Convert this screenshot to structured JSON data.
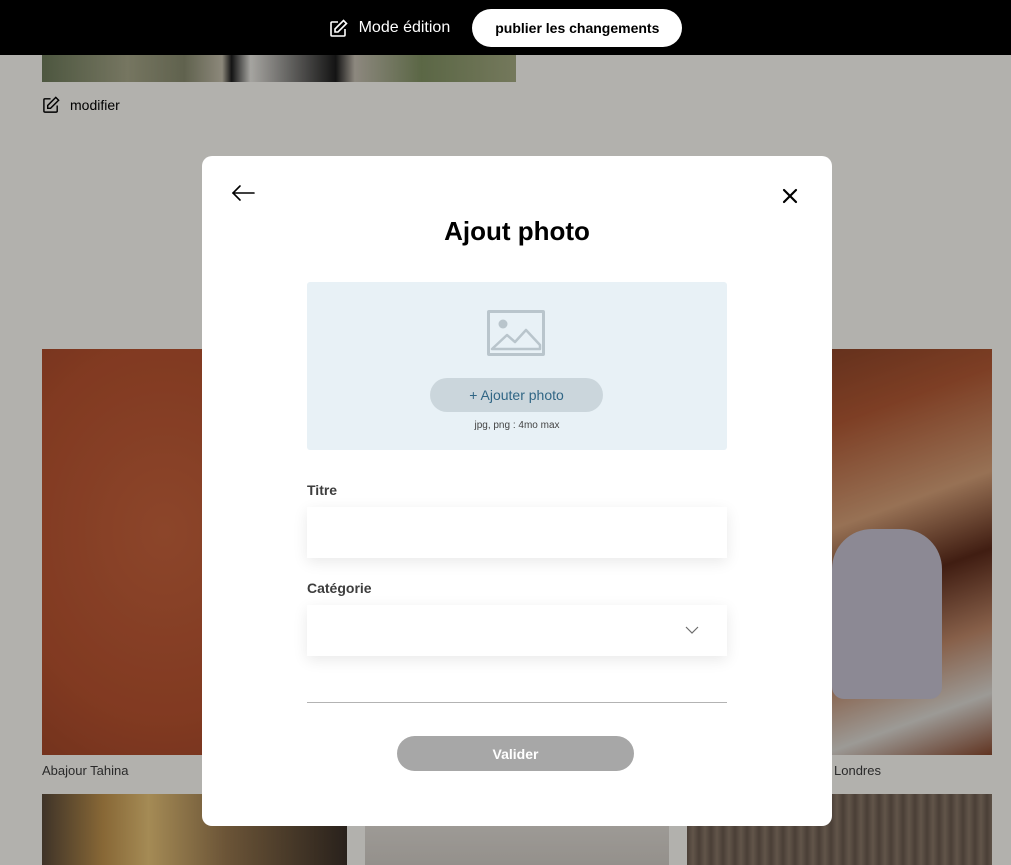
{
  "edit_bar": {
    "mode_label": "Mode édition",
    "publish_label": "publier les changements"
  },
  "intro": {
    "edit_label": "modifier"
  },
  "gallery": {
    "captions": [
      "Abajour Tahina",
      "Londres"
    ]
  },
  "modal": {
    "title": "Ajout photo",
    "upload": {
      "add_label": "+ Ajouter photo",
      "hint": "jpg, png : 4mo max"
    },
    "fields": {
      "title_label": "Titre",
      "title_value": "",
      "category_label": "Catégorie",
      "category_value": ""
    },
    "submit_label": "Valider"
  },
  "colors": {
    "accent": "#1D6154",
    "upload_bg": "#E8F1F6",
    "add_btn_bg": "#CBD6DC",
    "add_btn_text": "#306685",
    "submit_disabled": "#A7A7A7"
  }
}
